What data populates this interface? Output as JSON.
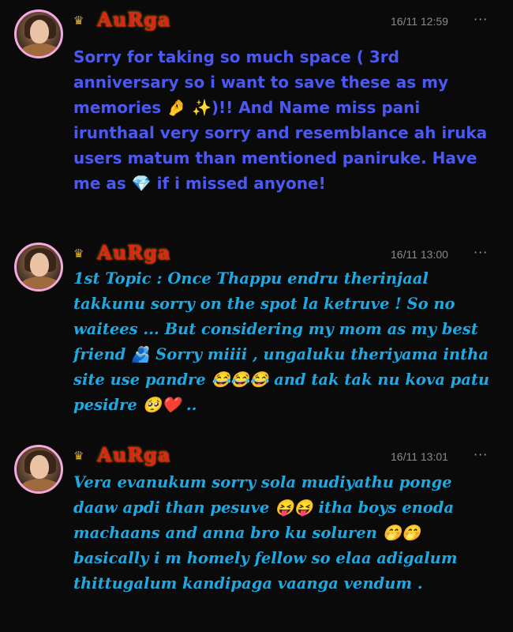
{
  "messages": [
    {
      "id": "msg1",
      "username": "AuRga",
      "crown_icon": "crown-icon",
      "timestamp": "16/11 12:59",
      "more_label": "···",
      "text": "Sorry for taking so much space ( 3rd anniversary so i want to save these as my memories 🤌 ✨)!! And Name miss pani irunthaal very sorry and resemblance ah iruka users matum than mentioned paniruke. Have me as 💎 if i missed anyone!",
      "text_color": "#4b59f2"
    },
    {
      "id": "msg2",
      "username": "AuRga",
      "crown_icon": "crown-icon",
      "timestamp": "16/11 13:00",
      "more_label": "···",
      "text": "1st Topic : Once Thappu endru therinjaal takkunu sorry on the spot la ketruve ! So no waitees ... But considering my mom as my best friend 🫂 Sorry miiii , ungaluku theriyama intha site use pandre 😂😂😂 and tak tak nu kova patu pesidre 🥺❤️ ..",
      "text_color": "#22a8e0"
    },
    {
      "id": "msg3",
      "username": "AuRga",
      "crown_icon": "crown-icon",
      "timestamp": "16/11 13:01",
      "more_label": "···",
      "text": "Vera evanukum sorry sola mudiyathu ponge daaw apdi than pesuve 😝😝 itha boys enoda machaans and anna bro ku soluren 🤭🤭 basically i m homely fellow so elaa adigalum thittugalum kandipaga vaanga vendum .",
      "text_color": "#22a8e0"
    }
  ],
  "colors": {
    "background": "#0a0a0a",
    "avatar_border": "#f3a9de",
    "username": "#d8261a",
    "timestamp": "#8a8a8a"
  }
}
